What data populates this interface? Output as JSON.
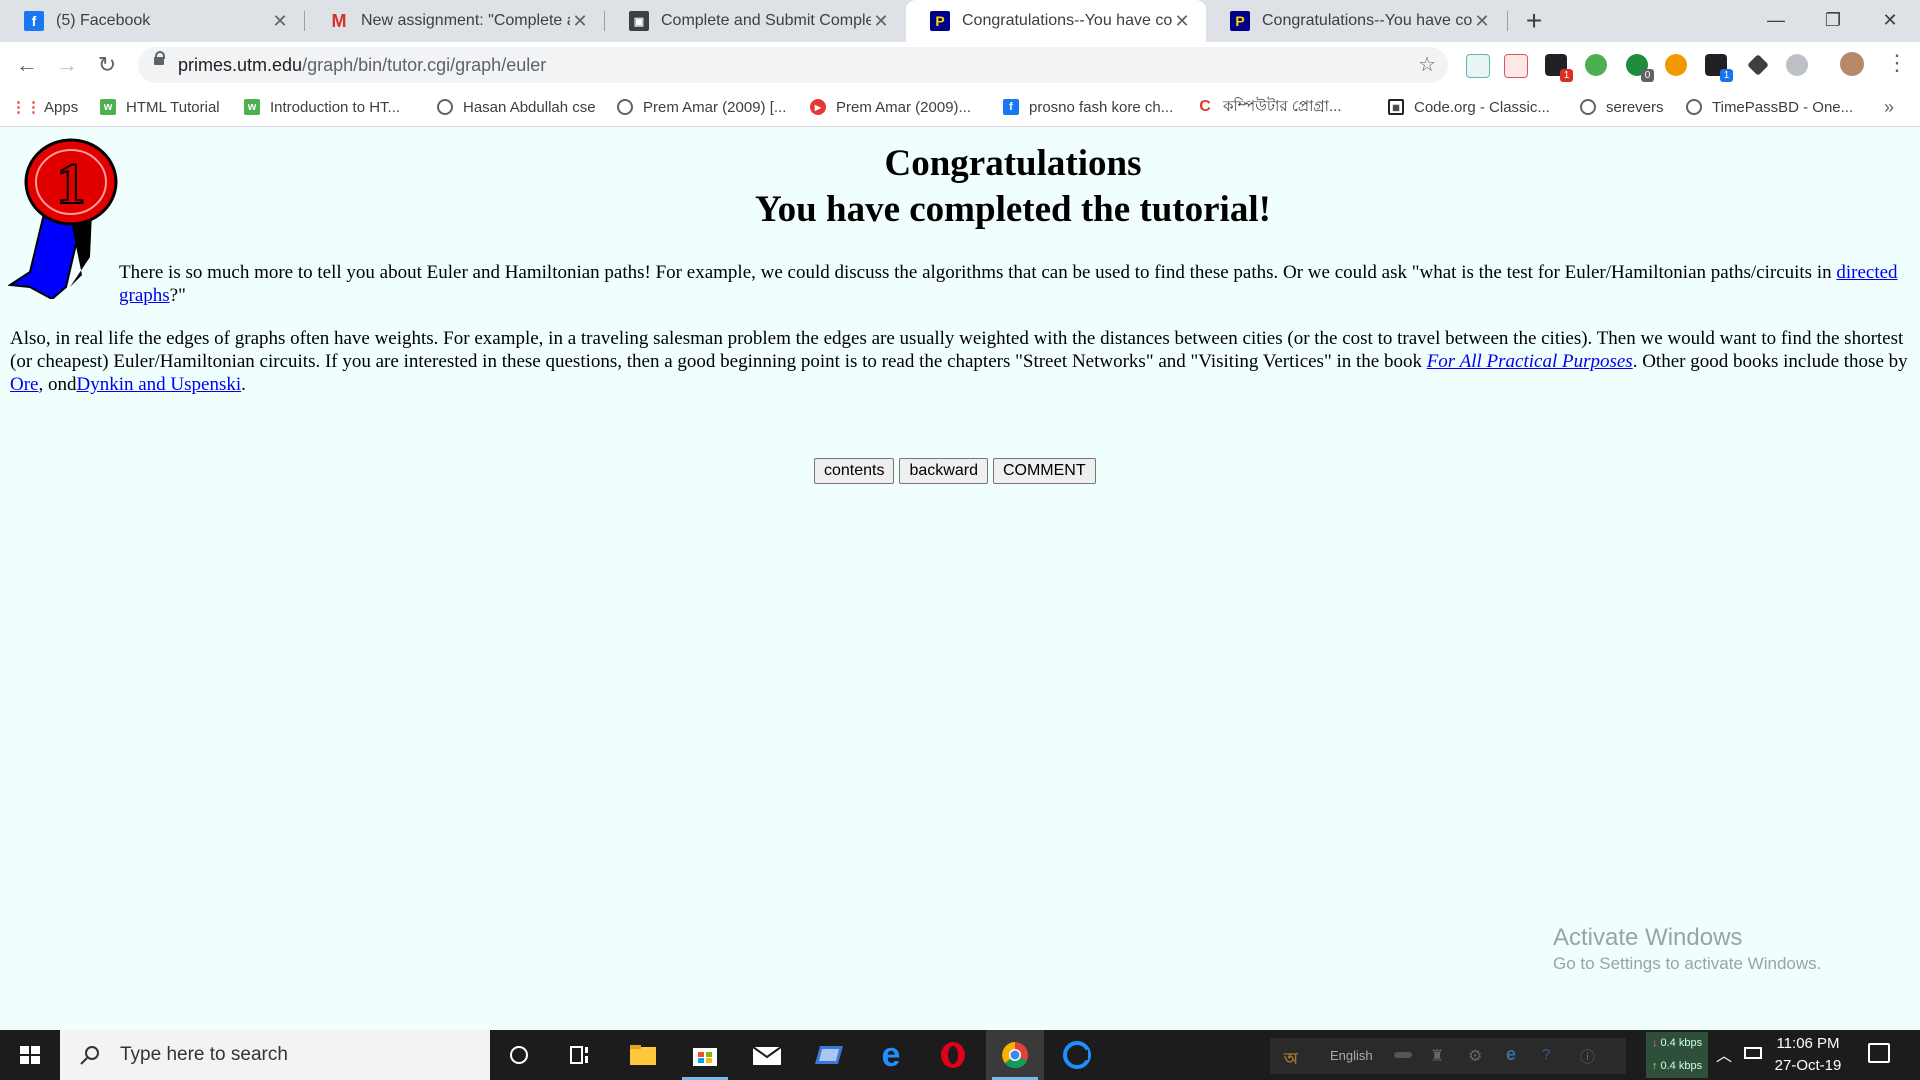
{
  "browser": {
    "tabs": [
      {
        "title": "(5) Facebook",
        "icon": "facebook-icon"
      },
      {
        "title": "New assignment: \"Complete and",
        "icon": "gmail-icon"
      },
      {
        "title": "Complete and Submit Completio",
        "icon": "classroom-icon"
      },
      {
        "title": "Congratulations--You have comp",
        "icon": "primes-icon"
      },
      {
        "title": "Congratulations--You have comp",
        "icon": "primes-icon"
      }
    ],
    "active_tab": 3,
    "url_host": "primes.utm.edu",
    "url_path": "/graph/bin/tutor.cgi/graph/euler",
    "bookmarks": [
      {
        "label": "Apps",
        "icon": "apps-grid-icon"
      },
      {
        "label": "HTML Tutorial",
        "icon": "w3schools-icon"
      },
      {
        "label": "Introduction to HT...",
        "icon": "w3schools-icon"
      },
      {
        "label": "Hasan Abdullah cse",
        "icon": "globe-icon"
      },
      {
        "label": "Prem Amar (2009) [...",
        "icon": "globe-icon"
      },
      {
        "label": "Prem Amar (2009)...",
        "icon": "youtube-icon"
      },
      {
        "label": "prosno fash kore ch...",
        "icon": "facebook-icon"
      },
      {
        "label": "কম্পিউটার প্রোগ্রা...",
        "icon": "c-logo-icon"
      },
      {
        "label": "Code.org - Classic...",
        "icon": "codeorg-icon"
      },
      {
        "label": "serevers",
        "icon": "globe-icon"
      },
      {
        "label": "TimePassBD - One...",
        "icon": "globe-icon"
      }
    ],
    "extension_badges": {
      "ext1": "1",
      "ext3": "0",
      "ext5": "1"
    }
  },
  "page": {
    "heading_line1": "Congratulations",
    "heading_line2": "You have completed the tutorial!",
    "para1_text": "There is so much more to tell you about Euler and Hamiltonian paths!  For example, we could discuss the algorithms that can be used to find these paths. Or we could ask \"what is the test for Euler/Hamiltonian paths/circuits in ",
    "para1_link": "directed graphs",
    "para1_end": "?\"",
    "para2_text": "Also, in real life the edges of graphs often have weights.  For example, in a traveling salesman problem the edges are usually weighted with the distances between cities (or the cost to travel between the cities).  Then we would want to find the shortest (or cheapest) Euler/Hamiltonian circuits.  If you are interested in these questions, then a good beginning point is to read the chapters \"Street Networks\" and \"Visiting Vertices\" in the book ",
    "para2_book": "For All Practical Purposes",
    "para2_mid": ". Other good books include those by ",
    "para2_link_ore": "Ore",
    "para2_sep": ", ond",
    "para2_link_dynkin": "Dynkin and Uspenski",
    "para2_end": ".",
    "buttons": {
      "contents": "contents",
      "backward": "backward",
      "comment": "COMMENT"
    },
    "ribbon_number": "1"
  },
  "watermark": {
    "line1": "Activate Windows",
    "line2": "Go to Settings to activate Windows."
  },
  "taskbar": {
    "search_placeholder": "Type here to search",
    "tray_language": "English",
    "net_down": "0.4 kbps",
    "net_up": "0.4 kbps",
    "time": "11:06 PM",
    "date": "27-Oct-19"
  },
  "colors": {
    "page_bg": "#f1fefe",
    "link": "#0000ee",
    "tabbar_bg": "#dee1e6",
    "taskbar_bg": "#1c1c1c"
  }
}
